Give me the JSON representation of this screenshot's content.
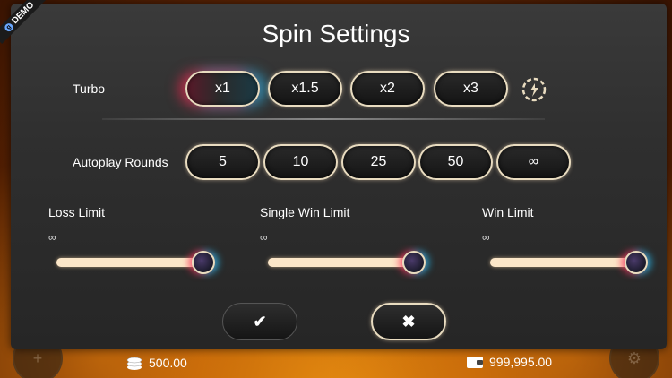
{
  "demo_badge": "DEMO",
  "title": "Spin Settings",
  "turbo": {
    "label": "Turbo",
    "options": [
      "x1",
      "x1.5",
      "x2",
      "x3"
    ],
    "selected": "x1",
    "icon": "turbo-speed-icon"
  },
  "autoplay": {
    "label": "Autoplay Rounds",
    "options": [
      "5",
      "10",
      "25",
      "50",
      "∞"
    ]
  },
  "limits": {
    "loss": {
      "label": "Loss Limit",
      "value": "∞",
      "fill_fraction": 1.0
    },
    "single_win": {
      "label": "Single Win Limit",
      "value": "∞",
      "fill_fraction": 1.0
    },
    "win": {
      "label": "Win Limit",
      "value": "∞",
      "fill_fraction": 1.0
    }
  },
  "actions": {
    "confirm_icon": "checkmark-icon",
    "cancel_icon": "close-icon"
  },
  "footer": {
    "bet": "500.00",
    "balance": "999,995.00"
  },
  "colors": {
    "accent_red": "#ff2850",
    "accent_cyan": "#28c8ff",
    "pill_border": "#e9dcc0",
    "slider_fill": "#fbe6c8"
  }
}
